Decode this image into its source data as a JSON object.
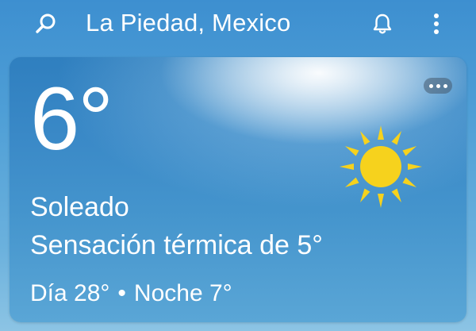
{
  "topbar": {
    "location": "La Piedad, Mexico",
    "icons": {
      "search": "search-icon",
      "notifications": "bell-icon",
      "menu": "more-vertical-icon"
    }
  },
  "card": {
    "temperature": "6°",
    "condition": "Soleado",
    "feels_like": "Sensación térmica de 5°",
    "day": "Día 28°",
    "separator": "•",
    "night": "Noche 7°",
    "weather_icon": "sun-icon",
    "more_icon": "more-horizontal-icon"
  },
  "colors": {
    "sun": "#f6d21d",
    "text": "#ffffff",
    "background_top": "#3d8fd0",
    "card_base": "#3a89c7"
  }
}
